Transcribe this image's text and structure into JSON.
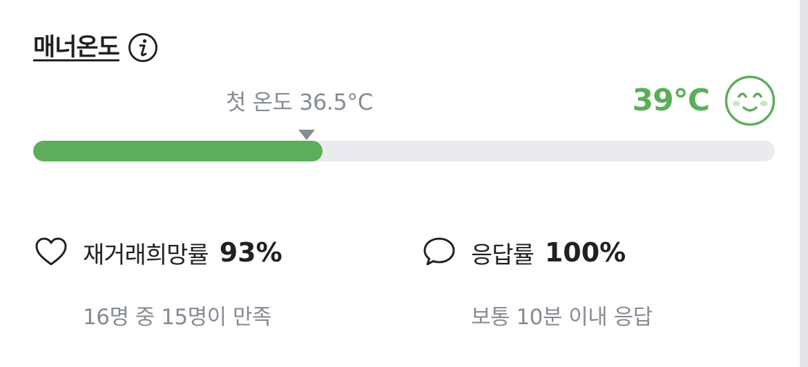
{
  "manner_temp": {
    "title": "매너온도",
    "first_temp_label": "첫 온도 36.5°C",
    "current_temp": "39°C",
    "progress_fraction": 0.39,
    "accent_color": "#5cae5b",
    "icons": {
      "info": "info-icon",
      "face": "smiling-face-icon"
    }
  },
  "stats": [
    {
      "icon": "heart-icon",
      "label": "재거래희망률",
      "value": "93%",
      "sub": "16명 중 15명이 만족"
    },
    {
      "icon": "speech-bubble-icon",
      "label": "응답률",
      "value": "100%",
      "sub": "보통 10분 이내 응답"
    }
  ]
}
